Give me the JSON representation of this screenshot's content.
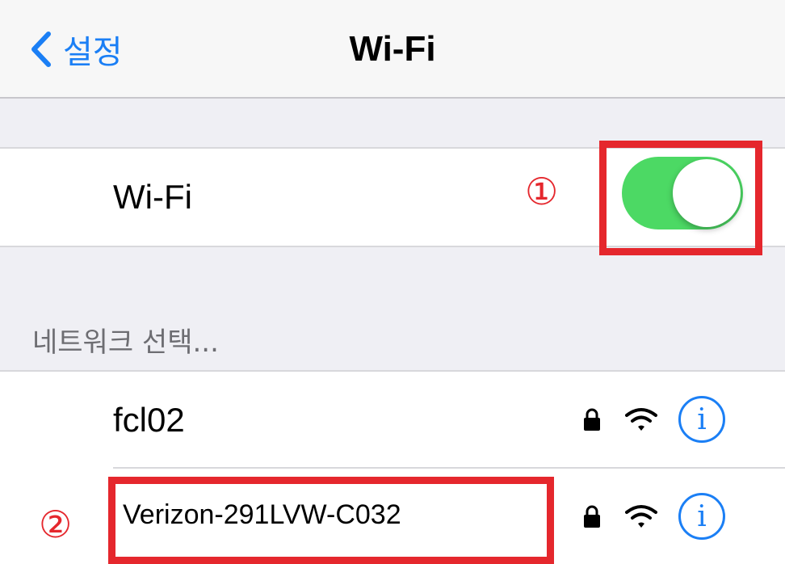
{
  "navbar": {
    "back_label": "설정",
    "title": "Wi-Fi"
  },
  "wifi_toggle": {
    "label": "Wi-Fi",
    "state": "on"
  },
  "annotations": {
    "marker_1": "①",
    "marker_2": "②"
  },
  "networks_section": {
    "header": "네트워크 선택..."
  },
  "networks": [
    {
      "name": "fcl02",
      "secured": true,
      "info": "i"
    },
    {
      "name": "Verizon-291LVW-C032",
      "secured": true,
      "info": "i"
    }
  ],
  "colors": {
    "accent": "#1b7ff5",
    "toggle_on": "#4cd964",
    "highlight": "#e5272d"
  },
  "icons": [
    "chevron-left-icon",
    "lock-icon",
    "wifi-icon",
    "info-icon"
  ]
}
